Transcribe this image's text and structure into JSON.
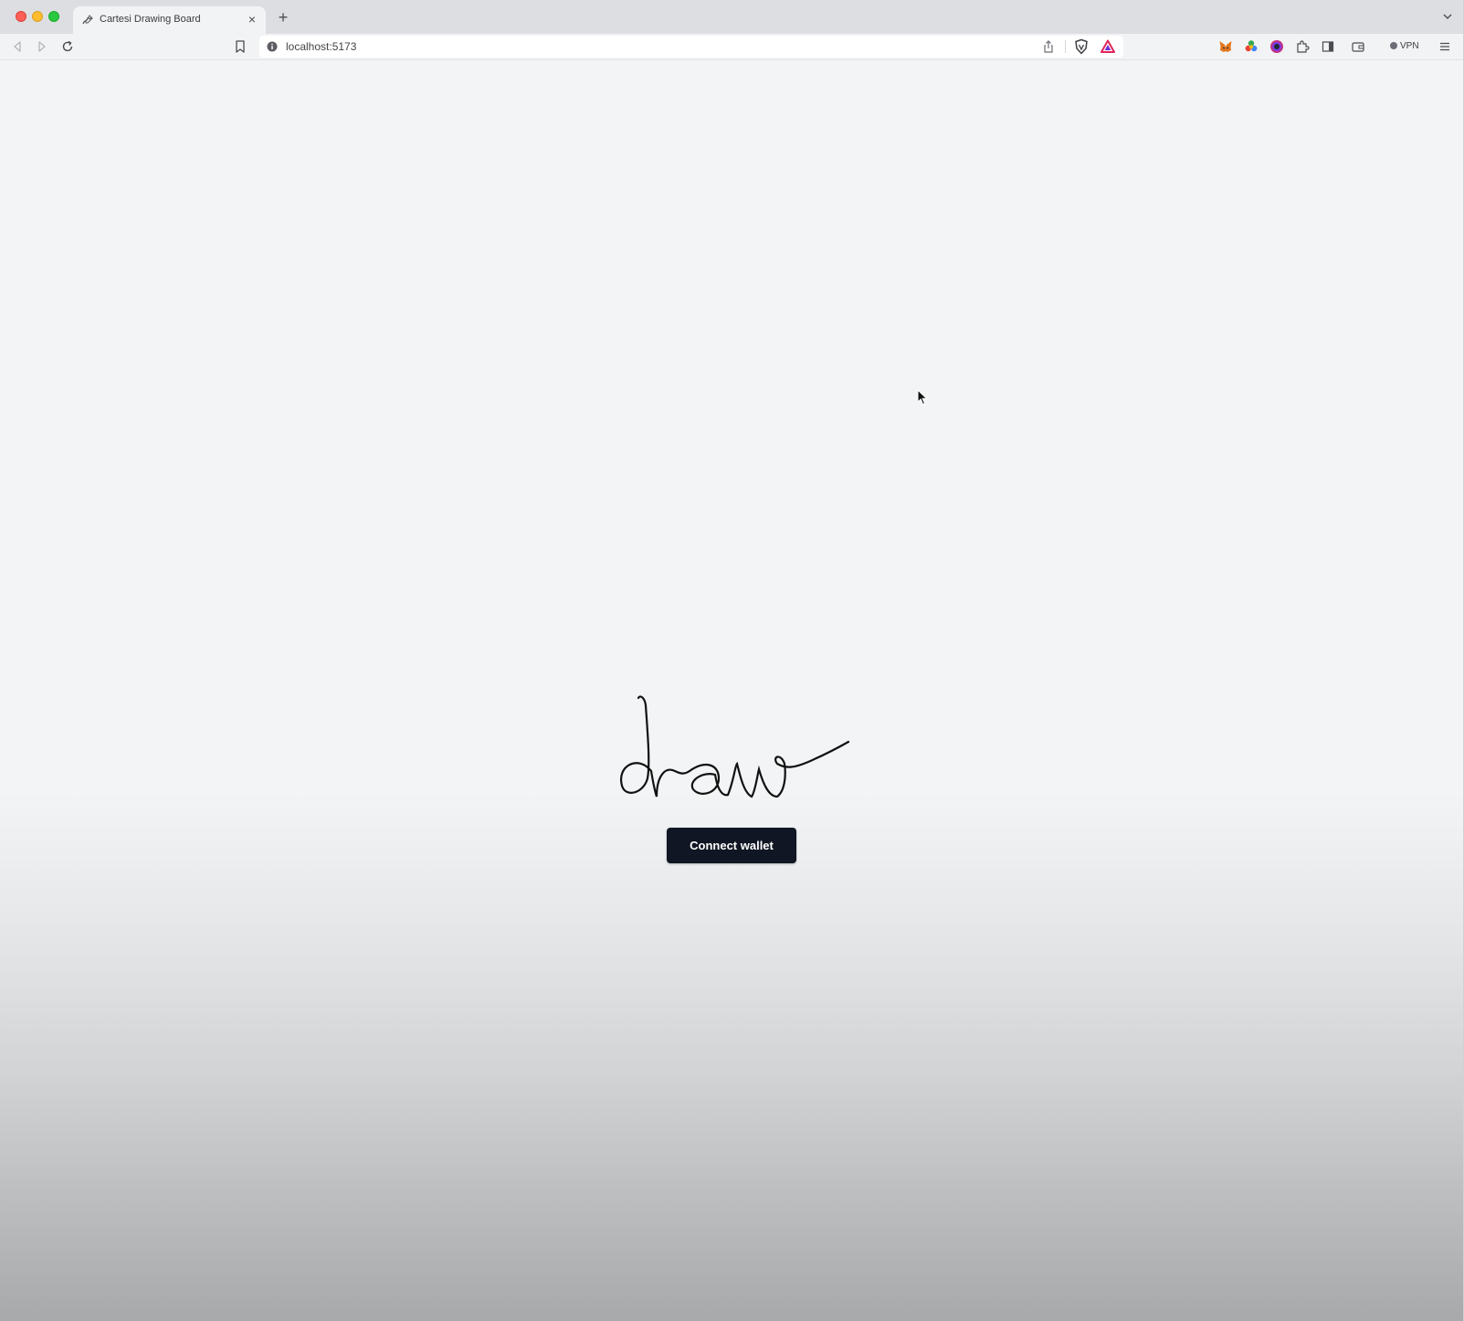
{
  "browser": {
    "tab": {
      "title": "Cartesi Drawing Board",
      "close_label": "×",
      "favicon": "pen-scribble-icon"
    },
    "new_tab_label": "+",
    "url": "localhost:5173",
    "vpn_label": "VPN",
    "toolbar_icons": [
      "back-icon",
      "forward-icon",
      "reload-icon",
      "bookmark-icon",
      "share-icon",
      "brave-shields-icon",
      "brave-rewards-icon",
      "metamask-icon",
      "extension-color-icon",
      "extension-circle-icon",
      "extensions-puzzle-icon",
      "sidebar-icon",
      "wallet-icon",
      "menu-icon"
    ]
  },
  "main": {
    "logo_word": "draw",
    "connect_button_label": "Connect wallet"
  },
  "colors": {
    "button_bg": "#101623",
    "page_bg_top": "#f3f4f5",
    "page_bg_bottom": "#a8a9ab"
  }
}
